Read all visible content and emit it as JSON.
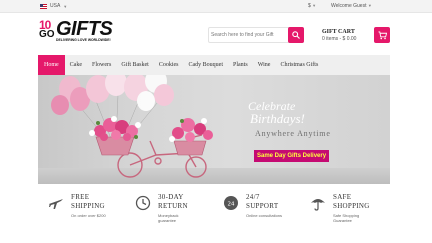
{
  "topbar": {
    "country": "USA",
    "currency": "$",
    "welcome": "Welcome Guest"
  },
  "logo": {
    "ten": "10",
    "go": "GO",
    "word": "GIFTS",
    "tagline": "DELIVERING LOVE WORLDWIDE!"
  },
  "search": {
    "placeholder": "Search here to find your Gift"
  },
  "cart": {
    "label": "GIFT CART",
    "items": "0 items - $ 0.00"
  },
  "nav": [
    {
      "label": "Home",
      "active": true
    },
    {
      "label": "Cake"
    },
    {
      "label": "Flowers"
    },
    {
      "label": "Gift Basket"
    },
    {
      "label": "Cookies"
    },
    {
      "label": "Cady Bouquet"
    },
    {
      "label": "Plants"
    },
    {
      "label": "Wine"
    },
    {
      "label": "Christmas Gifts"
    }
  ],
  "banner": {
    "line1": "Celebrate",
    "line2": "Birthdays!",
    "line3": "Anywhere Anytime",
    "badge": "Same Day Gifts Delivery"
  },
  "features": [
    {
      "icon": "airplane-icon",
      "title1": "FREE",
      "title2": "SHIPPING",
      "sub1": "On order over $200",
      "sub2": ""
    },
    {
      "icon": "clock-icon",
      "title1": "30-DAY",
      "title2": "RETURN",
      "sub1": "Moneyback",
      "sub2": "guarantee"
    },
    {
      "icon": "headset-24-icon",
      "title1": "24/7",
      "title2": "SUPPORT",
      "sub1": "Online consultations",
      "sub2": ""
    },
    {
      "icon": "umbrella-icon",
      "title1": "SAFE",
      "title2": "SHOPPING",
      "sub1": "Safe Shopping",
      "sub2": "Guarantee"
    }
  ],
  "colors": {
    "accent": "#e5186a",
    "badge_bg": "#c50a72",
    "badge_text": "#ffff3d"
  }
}
